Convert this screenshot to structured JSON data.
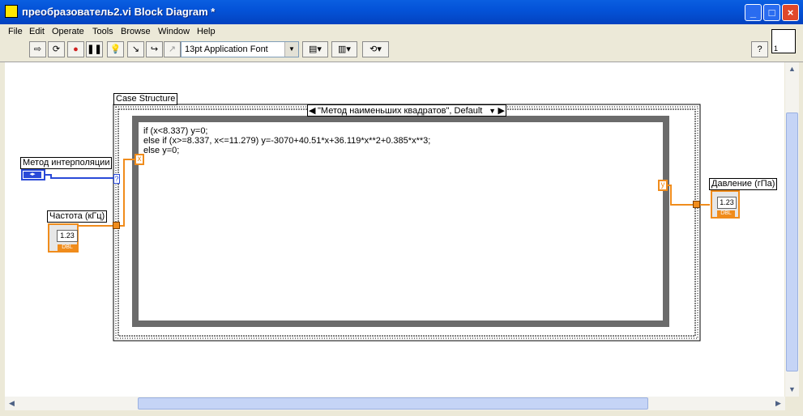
{
  "window": {
    "title": "преобразователь2.vi Block Diagram *",
    "buttons": [
      "_",
      "□",
      "×"
    ]
  },
  "menu": [
    "File",
    "Edit",
    "Operate",
    "Tools",
    "Browse",
    "Window",
    "Help"
  ],
  "toolbar": {
    "font": "13pt Application Font",
    "help": "?",
    "vi_icon_label": "1"
  },
  "diagram": {
    "case_structure_label": "Case Structure",
    "case_selector": "\"Метод наименьших квадратов\", Default",
    "formula_lines": [
      "if (x<8.337) y=0;",
      "else if (x>=8.337, x<=11.279) y=-3070+40.51*x+36.119*x**2+0.385*x**3;",
      "else y=0;"
    ],
    "input_var": "x",
    "output_var": "y",
    "selector_terminal": "?",
    "controls": {
      "method": "Метод интерполяции",
      "freq": "Частота (кГц)",
      "pressure": "Давление (гПа)"
    },
    "numeric_value": "1.23",
    "type_label": "DBL"
  },
  "colors": {
    "float_wire": "#f08c1c",
    "enum_wire": "#2a4ad8"
  }
}
